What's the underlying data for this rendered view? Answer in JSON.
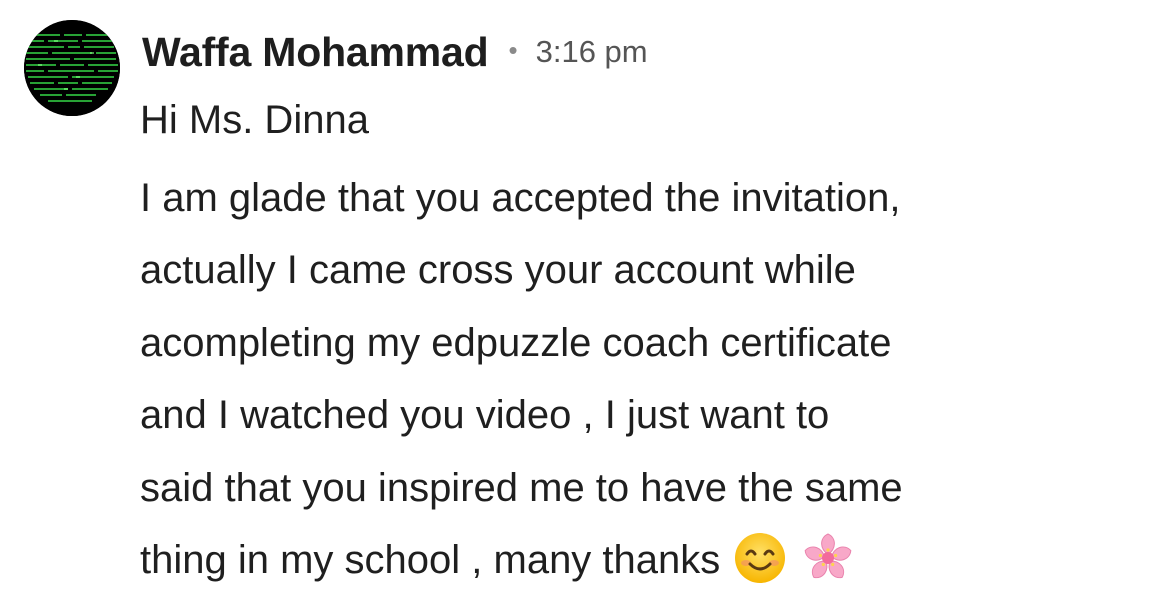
{
  "message": {
    "sender": "Waffa Mohammad",
    "separator": "•",
    "time": "3:16 pm",
    "greeting": "Hi Ms. Dinna",
    "lines": [
      "I am glade that you accepted the invitation,",
      "actually I came cross your account while",
      "acompleting my edpuzzle coach certificate",
      "and I watched you video , I just want to",
      "said that you inspired me to have the same",
      "thing in my school , many thanks"
    ],
    "emojis": [
      "smiling-face-emoji",
      "cherry-blossom-emoji"
    ]
  },
  "colors": {
    "text": "#1f1f1f",
    "time": "#555555",
    "avatar_bg": "#000000",
    "avatar_code": "#2fbf3f"
  }
}
